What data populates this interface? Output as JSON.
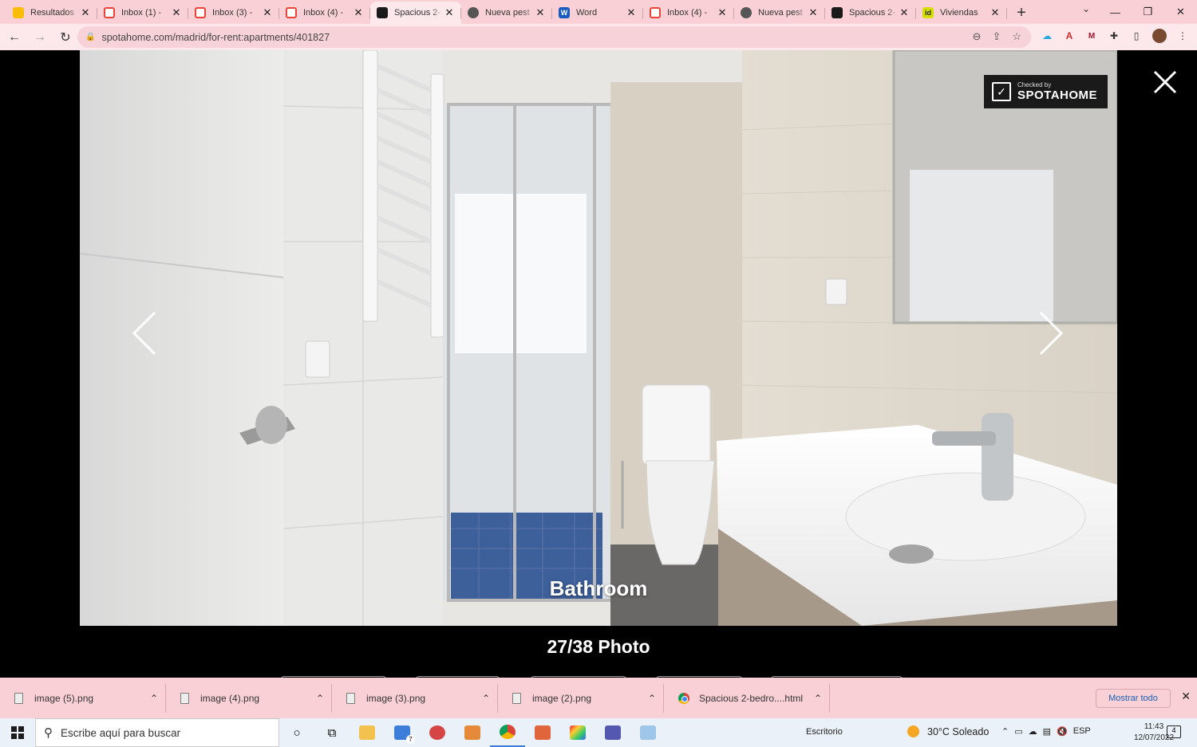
{
  "browser": {
    "tabs": [
      {
        "label": "Resultados",
        "favicon": "google-drive-icon",
        "color": "#fbbc04",
        "active": false
      },
      {
        "label": "Inbox (1) -",
        "favicon": "gmail-icon",
        "color": "#ea4335",
        "active": false
      },
      {
        "label": "Inbox (3) -",
        "favicon": "gmail-icon",
        "color": "#ea4335",
        "active": false
      },
      {
        "label": "Inbox (4) -",
        "favicon": "gmail-icon",
        "color": "#ea4335",
        "active": false
      },
      {
        "label": "Spacious 2-",
        "favicon": "spotahome-icon",
        "color": "#1a1a1a",
        "active": true
      },
      {
        "label": "Nueva pest",
        "favicon": "chrome-icon",
        "color": "#555555",
        "active": false
      },
      {
        "label": "Word",
        "favicon": "word-icon",
        "color": "#185abd",
        "active": false
      },
      {
        "label": "Inbox (4) -",
        "favicon": "gmail-icon",
        "color": "#ea4335",
        "active": false
      },
      {
        "label": "Nueva pest",
        "favicon": "chrome-icon",
        "color": "#555555",
        "active": false
      },
      {
        "label": "Spacious 2-",
        "favicon": "spotahome-icon",
        "color": "#1a1a1a",
        "active": false
      },
      {
        "label": "Viviendas",
        "favicon": "idealista-icon",
        "color": "#d6e000",
        "active": false
      }
    ],
    "favicon_text": {
      "word": "W",
      "idealista": "id"
    },
    "url": "spotahome.com/madrid/for-rent:apartments/401827"
  },
  "viewer": {
    "caption": "Bathroom",
    "counter": "27/38 Photo",
    "watermark_small": "Checked by",
    "watermark_brand": "SPOTAHOME"
  },
  "downloads": {
    "items": [
      {
        "label": "image (5).png",
        "type": "image"
      },
      {
        "label": "image (4).png",
        "type": "image"
      },
      {
        "label": "image (3).png",
        "type": "image"
      },
      {
        "label": "image (2).png",
        "type": "image"
      },
      {
        "label": "Spacious 2-bedro....html",
        "type": "html"
      }
    ],
    "show_all": "Mostrar todo"
  },
  "taskbar": {
    "search_placeholder": "Escribe aquí para buscar",
    "desktop_label": "Escritorio",
    "weather": "30°C  Soleado",
    "language": "ESP",
    "time": "11:43",
    "date": "12/07/2022",
    "notifications": "4",
    "mail_badge": "7"
  }
}
